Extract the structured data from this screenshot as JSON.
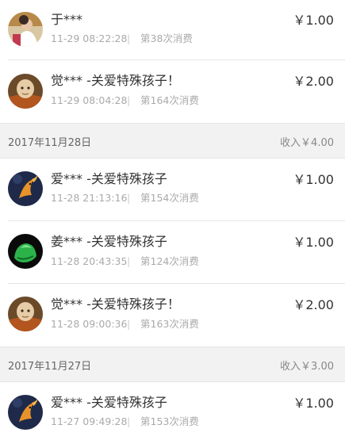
{
  "transactions": [
    {
      "name": "于***",
      "time": "11-29 08:22:28",
      "sep": "|",
      "count": "第38次消费",
      "amount": "￥1.00",
      "avatar": "avatar-photo"
    },
    {
      "name": "觉*** -关爱特殊孩子！",
      "time": "11-29 08:04:28",
      "sep": "|",
      "count": "第164次消费",
      "amount": "￥2.00",
      "avatar": "avatar-monk"
    },
    {
      "name": "爱*** -关爱特殊孩子",
      "time": "11-28 21:13:16",
      "sep": "|",
      "count": "第154次消费",
      "amount": "￥1.00",
      "avatar": "avatar-fish"
    },
    {
      "name": "姜*** -关爱特殊孩子",
      "time": "11-28 20:43:35",
      "sep": "|",
      "count": "第124次消费",
      "amount": "￥1.00",
      "avatar": "avatar-jade"
    },
    {
      "name": "觉*** -关爱特殊孩子！",
      "time": "11-28 09:00:36",
      "sep": "|",
      "count": "第163次消费",
      "amount": "￥2.00",
      "avatar": "avatar-monk"
    },
    {
      "name": "爱*** -关爱特殊孩子",
      "time": "11-27 09:49:28",
      "sep": "|",
      "count": "第153次消费",
      "amount": "￥1.00",
      "avatar": "avatar-fish"
    }
  ],
  "day_headers": [
    {
      "date": "2017年11月28日",
      "income": "收入￥4.00"
    },
    {
      "date": "2017年11月27日",
      "income": "收入￥3.00"
    }
  ]
}
